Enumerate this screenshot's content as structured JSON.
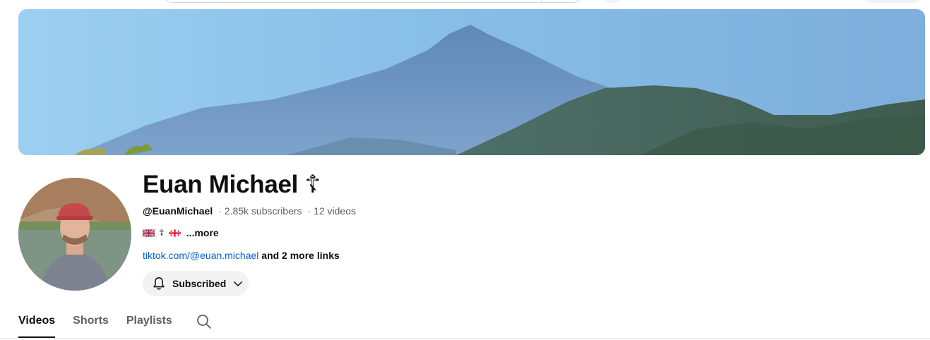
{
  "channel": {
    "name": "Euan Michael",
    "name_symbol": "☦",
    "handle": "@EuanMichael",
    "separator": "·",
    "subscribers": "2.85k subscribers",
    "videos": "12 videos"
  },
  "description": {
    "cross": "☦",
    "more_label": "...more"
  },
  "links": {
    "primary": "tiktok.com/@euan.michael",
    "more": "and 2 more links"
  },
  "subscribe_button": {
    "label": "Subscribed",
    "icon": "bell-icon"
  },
  "tabs": [
    {
      "label": "Videos",
      "active": true
    },
    {
      "label": "Shorts",
      "active": false
    },
    {
      "label": "Playlists",
      "active": false
    }
  ],
  "colors": {
    "link": "#065fd4",
    "muted_text": "#606060",
    "button_bg": "#f2f2f2"
  }
}
